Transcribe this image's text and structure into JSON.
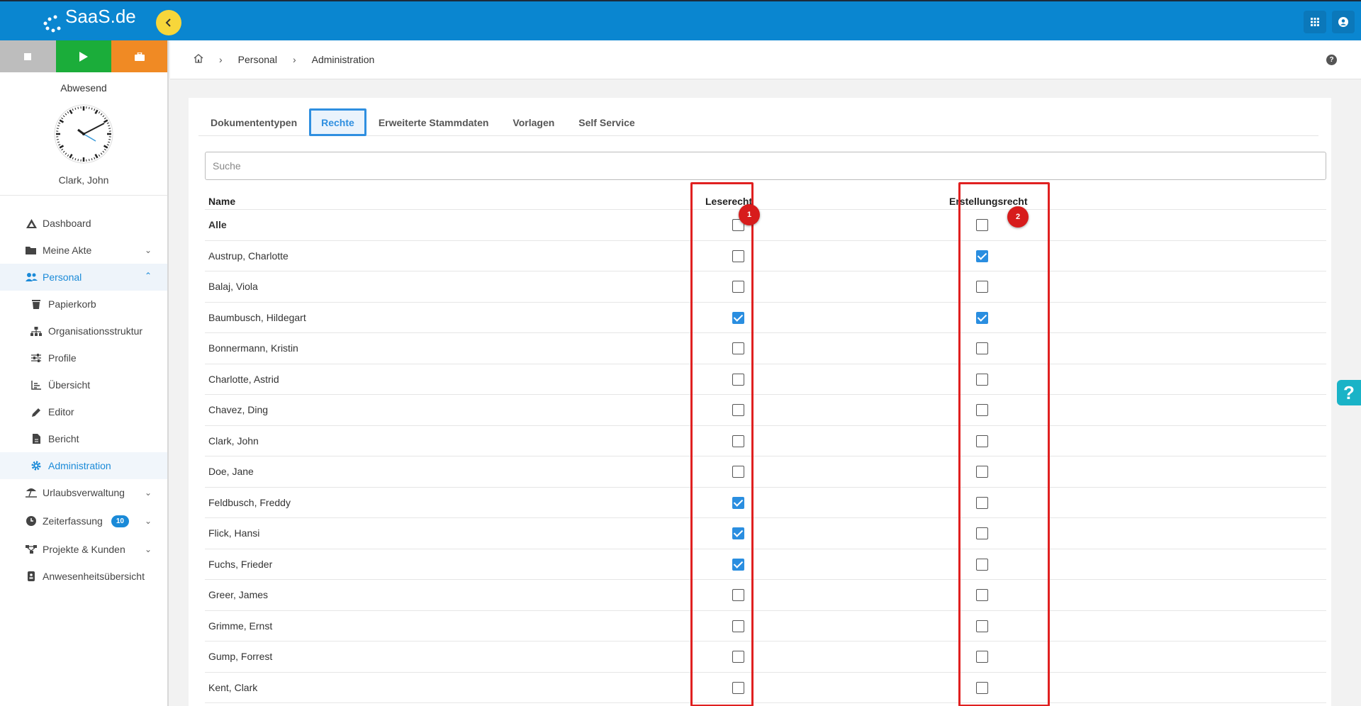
{
  "app": {
    "logo_text": "SaaS.de"
  },
  "colors": {
    "primary": "#0a86d0",
    "accent_yellow": "#f7d63a",
    "status_green": "#1bad3a",
    "status_orange": "#f08a24",
    "status_gray": "#bdbdbd",
    "checkbox_checked": "#2a8ee0",
    "highlight_red": "#e02020"
  },
  "sidebar": {
    "status_label": "Abwesend",
    "user_name": "Clark, John",
    "items": [
      {
        "label": "Dashboard",
        "icon": "dashboard-icon"
      },
      {
        "label": "Meine Akte",
        "icon": "folder-icon"
      },
      {
        "label": "Personal",
        "icon": "users-icon"
      },
      {
        "label": "Papierkorb",
        "icon": "trash-icon"
      },
      {
        "label": "Organisationsstruktur",
        "icon": "sitemap-icon"
      },
      {
        "label": "Profile",
        "icon": "sliders-icon"
      },
      {
        "label": "Übersicht",
        "icon": "chart-icon"
      },
      {
        "label": "Editor",
        "icon": "pencil-icon"
      },
      {
        "label": "Bericht",
        "icon": "report-icon"
      },
      {
        "label": "Administration",
        "icon": "gear-icon"
      },
      {
        "label": "Urlaubsverwaltung",
        "icon": "beach-icon"
      },
      {
        "label": "Zeiterfassung",
        "icon": "clock-icon",
        "badge": "10"
      },
      {
        "label": "Projekte & Kunden",
        "icon": "project-icon"
      },
      {
        "label": "Anwesenheitsübersicht",
        "icon": "badge-icon"
      }
    ]
  },
  "breadcrumb": {
    "items": [
      "Personal",
      "Administration"
    ]
  },
  "tabs": [
    "Dokumententypen",
    "Rechte",
    "Erweiterte Stammdaten",
    "Vorlagen",
    "Self Service"
  ],
  "search": {
    "placeholder": "Suche",
    "value": ""
  },
  "table": {
    "headers": {
      "name": "Name",
      "read": "Leserecht",
      "create": "Erstellungsrecht"
    },
    "rows": [
      {
        "name": "Alle",
        "read": false,
        "create": false
      },
      {
        "name": "Austrup, Charlotte",
        "read": false,
        "create": true
      },
      {
        "name": "Balaj, Viola",
        "read": false,
        "create": false
      },
      {
        "name": "Baumbusch, Hildegart",
        "read": true,
        "create": true
      },
      {
        "name": "Bonnermann, Kristin",
        "read": false,
        "create": false
      },
      {
        "name": "Charlotte, Astrid",
        "read": false,
        "create": false
      },
      {
        "name": "Chavez, Ding",
        "read": false,
        "create": false
      },
      {
        "name": "Clark, John",
        "read": false,
        "create": false
      },
      {
        "name": "Doe, Jane",
        "read": false,
        "create": false
      },
      {
        "name": "Feldbusch, Freddy",
        "read": true,
        "create": false
      },
      {
        "name": "Flick, Hansi",
        "read": true,
        "create": false
      },
      {
        "name": "Fuchs, Frieder",
        "read": true,
        "create": false
      },
      {
        "name": "Greer, James",
        "read": false,
        "create": false
      },
      {
        "name": "Grimme, Ernst",
        "read": false,
        "create": false
      },
      {
        "name": "Gump, Forrest",
        "read": false,
        "create": false
      },
      {
        "name": "Kent, Clark",
        "read": false,
        "create": false
      }
    ]
  },
  "annotations": {
    "marker_1": "1",
    "marker_2": "2"
  }
}
